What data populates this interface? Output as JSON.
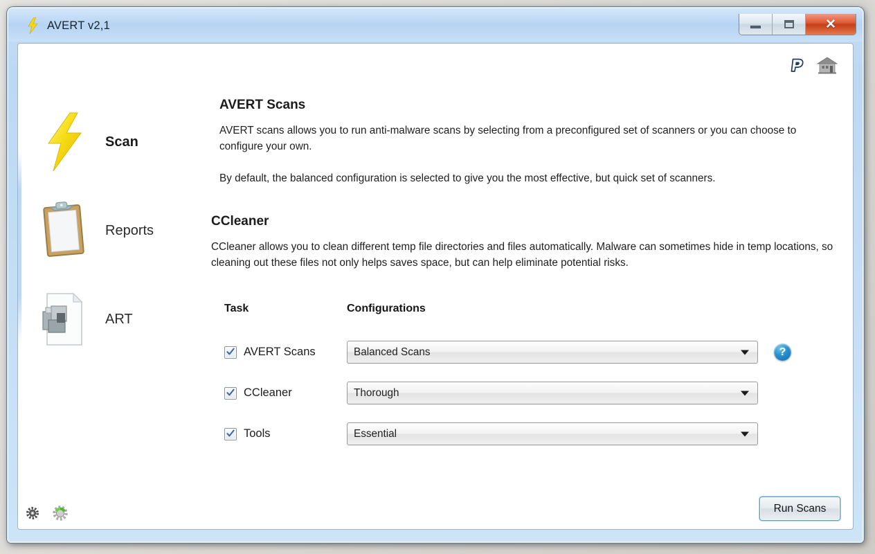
{
  "window": {
    "title": "AVERT v2,1",
    "app_icon": "lightning-bolt-icon",
    "controls": {
      "minimize": "minimize-button",
      "maximize": "maximize-button",
      "close": "close-button"
    }
  },
  "top_icons": [
    {
      "name": "paypal-icon",
      "label": "P"
    },
    {
      "name": "home-icon",
      "label": "Home"
    }
  ],
  "sidebar": {
    "items": [
      {
        "label": "Scan",
        "icon": "lightning-bolt-icon",
        "active": true
      },
      {
        "label": "Reports",
        "icon": "clipboard-icon",
        "active": false
      },
      {
        "label": "ART",
        "icon": "document-gears-icon",
        "active": false
      }
    ]
  },
  "main": {
    "sections": [
      {
        "heading": "AVERT Scans",
        "paragraphs": [
          "AVERT scans allows you to run anti-malware scans by selecting from a preconfigured set of scanners or you can choose to configure your own.",
          "By default, the balanced configuration is selected to give you the most effective, but quick set of scanners."
        ]
      },
      {
        "heading": "CCleaner",
        "paragraphs": [
          "CCleaner allows you to clean different temp file directories and files automatically. Malware can sometimes hide in temp locations, so cleaning out these files not only helps saves space, but can help eliminate potential risks."
        ]
      }
    ],
    "table": {
      "headers": {
        "task": "Task",
        "configurations": "Configurations"
      },
      "rows": [
        {
          "label": "AVERT Scans",
          "checked": true,
          "configuration": "Balanced Scans",
          "has_help": true
        },
        {
          "label": "CCleaner",
          "checked": true,
          "configuration": "Thorough",
          "has_help": false
        },
        {
          "label": "Tools",
          "checked": true,
          "configuration": "Essential",
          "has_help": false
        }
      ],
      "help_label": "?"
    }
  },
  "footer": {
    "run_button": "Run Scans",
    "icons": [
      {
        "name": "gear-dark-icon"
      },
      {
        "name": "gear-green-icon"
      }
    ]
  },
  "colors": {
    "titlebar": "#bcd8f3",
    "accent_blue": "#2a92cf",
    "bolt_yellow": "#f2d01c",
    "close_red": "#c63e16",
    "green_gear": "#4eb82e"
  }
}
